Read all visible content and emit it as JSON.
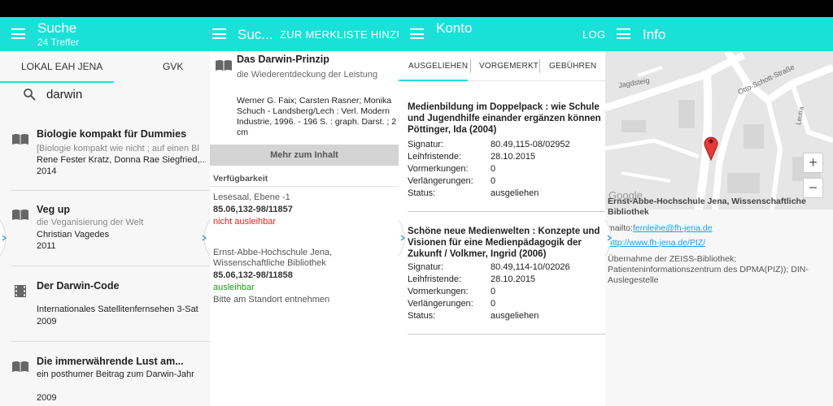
{
  "colors": {
    "accent": "#19e1d8",
    "red": "#e02020",
    "green": "#1a9a1a",
    "link": "#1e9fe0"
  },
  "search_screen": {
    "title": "Suche",
    "subtitle": "24 Treffer",
    "tabs": [
      "LOKAL EAH JENA",
      "GVK"
    ],
    "query": "darwin",
    "results": [
      {
        "icon": "book-icon",
        "title": "Biologie kompakt für Dummies",
        "line1": "[Biologie kompakt wie nicht ; auf einen Bl",
        "line2": "Rene Fester Kratz, Donna Rae Siegfried,...",
        "line3": "2014"
      },
      {
        "icon": "book-icon",
        "title": "Veg up",
        "line1": "die Veganisierung der Welt",
        "line2": "Christian Vagedes",
        "line3": "2011"
      },
      {
        "icon": "film-icon",
        "title": "Der Darwin-Code",
        "line1": "",
        "line2": "Internationales Satellitenfernsehen 3-Sat",
        "line3": "2009"
      },
      {
        "icon": "book-icon",
        "title": "Die immerwährende Lust am...",
        "line1": "ein posthumer Beitrag zum Darwin-Jahr",
        "line2": "",
        "line3": "2009"
      }
    ]
  },
  "detail_screen": {
    "title": "Suc...",
    "action": "ZUR MERKLISTE HINZUFÜ",
    "book_title": "Das Darwin-Prinzip",
    "book_subtitle": "die Wiederentdeckung der Leistung",
    "details": [
      "Werner G. Faix; Carsten Rasner; Monika",
      "Schuch - Landsberg/Lech : Verl. Modern",
      "Industrie, 1996. - 196 S. : graph. Darst. ; 2",
      "cm"
    ],
    "more_button": "Mehr zum Inhalt",
    "availability_header": "Verfügbarkeit",
    "holdings": [
      {
        "location": [
          "Lesesaal, Ebene -1"
        ],
        "signature": "85.06,132-98/11857",
        "status": "nicht ausleihbar",
        "status_type": "red",
        "note": ""
      },
      {
        "location": [
          "Ernst-Abbe-Hochschule Jena,",
          "Wissenschaftliche Bibliothek"
        ],
        "signature": "85.06,132-98/11858",
        "status": "ausleihbar",
        "status_type": "green",
        "note": "Bitte am Standort entnehmen"
      }
    ]
  },
  "account_screen": {
    "title": "Konto",
    "action": "LOGO",
    "tabs": [
      "AUSGELIEHEN",
      "VORGEMERKT",
      "GEBÜHREN"
    ],
    "labels": {
      "signature": "Signatur:",
      "due": "Leihfristende:",
      "reservations": "Vormerkungen:",
      "renewals": "Verlängerungen:",
      "status": "Status:"
    },
    "loans": [
      {
        "title": [
          "Medienbildung im Doppelpack : wie Schule",
          "und Jugendhilfe einander ergänzen können",
          "Pöttinger, Ida (2004)"
        ],
        "signature": "80.49,115-08/02952",
        "due": "28.10.2015",
        "reservations": "0",
        "renewals": "0",
        "status": "ausgeliehen"
      },
      {
        "title": [
          "Schöne neue Medienwelten : Konzepte und",
          "Visionen für eine Medienpädagogik der",
          "Zukunft / Volkmer, Ingrid (2006)"
        ],
        "signature": "80.49,114-10/02026",
        "due": "28.10.2015",
        "reservations": "0",
        "renewals": "0",
        "status": "ausgeliehen"
      }
    ]
  },
  "info_screen": {
    "title": "Info",
    "map": {
      "streets": [
        "Jagdsteig",
        "Otto-Schott-Straße",
        "Leutra"
      ],
      "attribution": "Google",
      "zoom_in": "+",
      "zoom_out": "−"
    },
    "library_name": [
      "Ernst-Abbe-Hochschule Jena, Wissenschaftliche",
      "Bibliothek"
    ],
    "email_prefix": "mailto:",
    "email": "fernleihe@fh-jena.de",
    "url": "http://www.fh-jena.de/PIZ/",
    "note": [
      "Übernahme der ZEISS-Bibliothek;",
      "Patienteninformationszentrum des DPMA(PIZ)); DIN-",
      "Auslegestelle"
    ]
  }
}
